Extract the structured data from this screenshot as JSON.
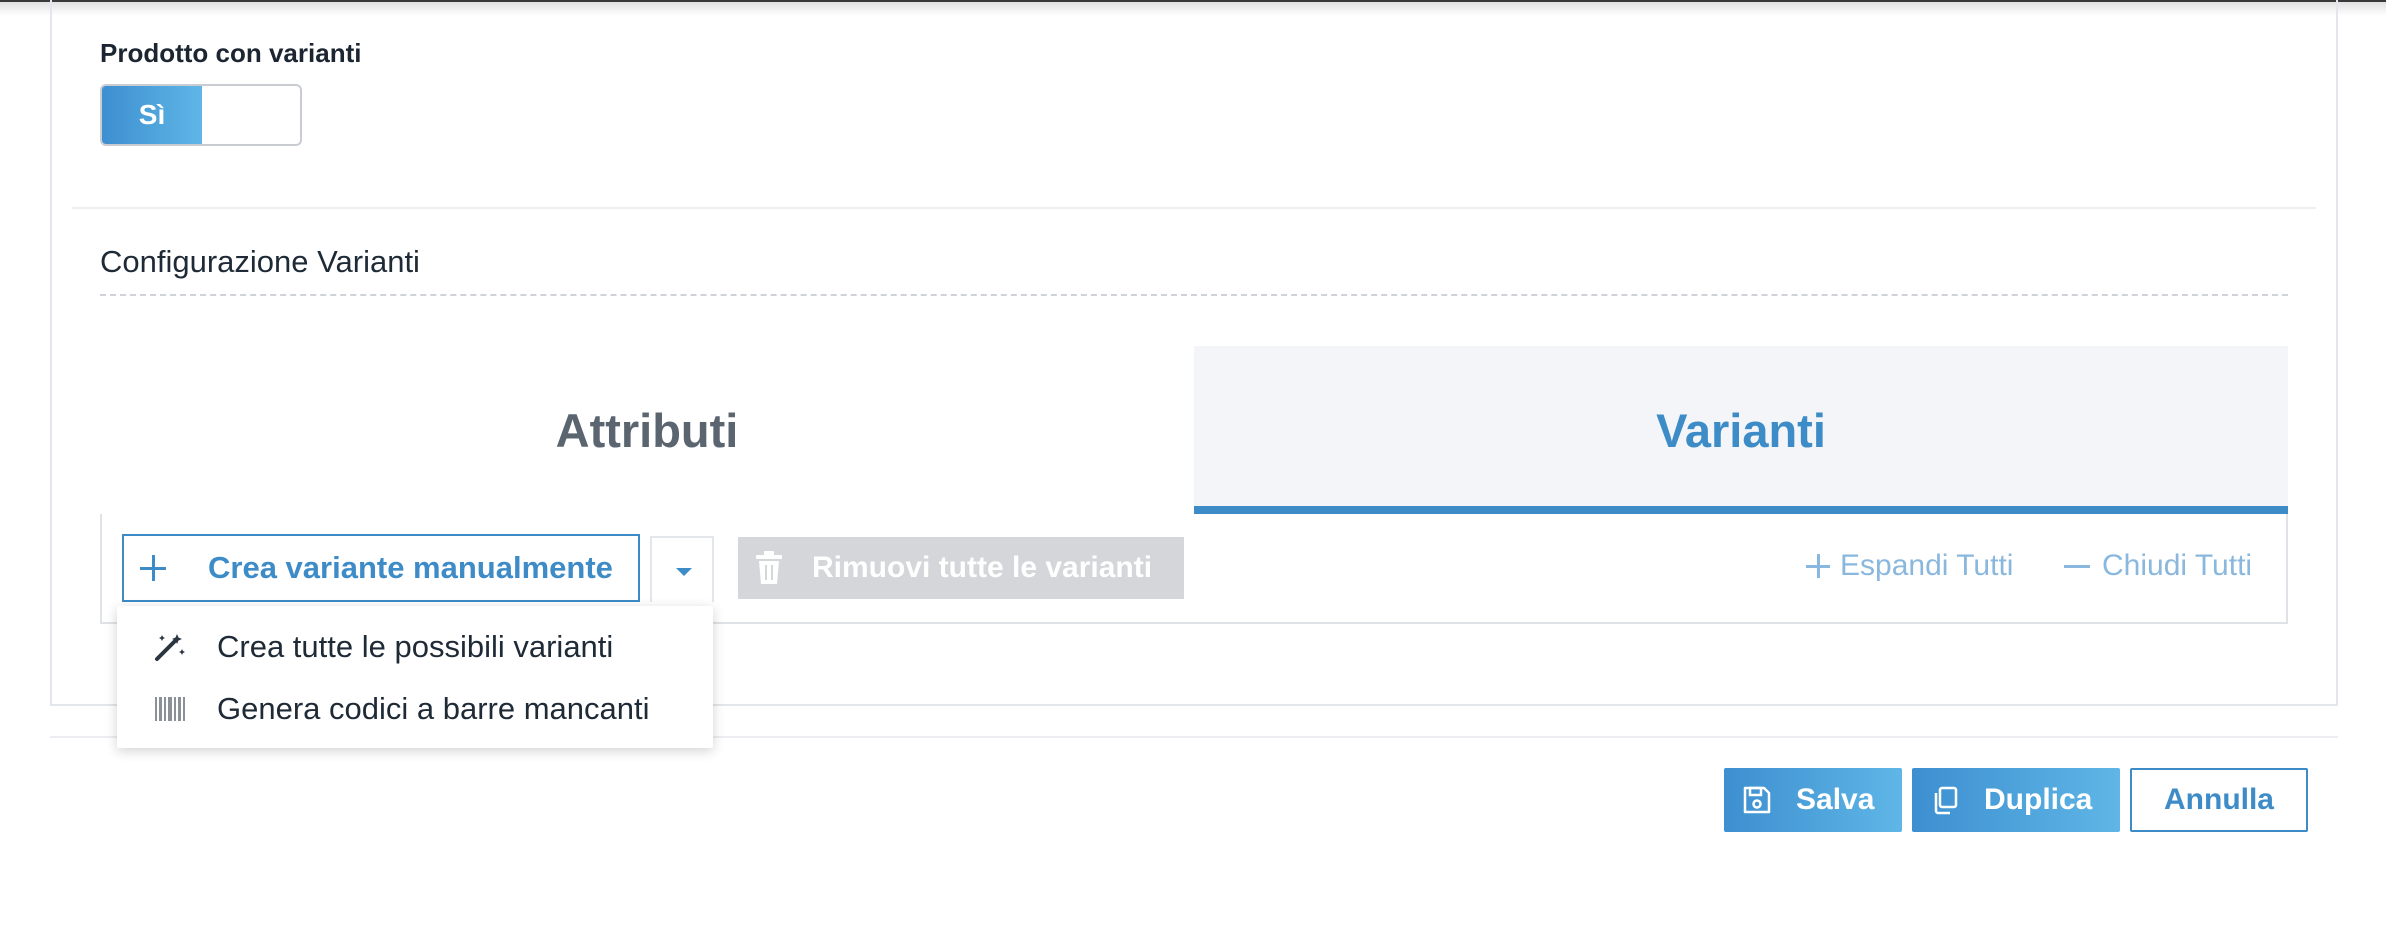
{
  "product_variants": {
    "label": "Prodotto con varianti",
    "toggle_on_label": "Sì"
  },
  "config": {
    "title": "Configurazione Varianti"
  },
  "tabs": [
    {
      "label": "Attributi",
      "active": false
    },
    {
      "label": "Varianti",
      "active": true
    }
  ],
  "toolbar": {
    "create_manual_label": "Crea variante manualmente",
    "remove_all_label": "Rimuovi tutte le varianti",
    "expand_all_label": "Espandi Tutti",
    "collapse_all_label": "Chiudi Tutti"
  },
  "dropdown": {
    "items": [
      {
        "label": "Crea tutte le possibili varianti",
        "icon": "magic-wand-icon"
      },
      {
        "label": "Genera codici a barre mancanti",
        "icon": "barcode-icon"
      }
    ]
  },
  "footer": {
    "save_label": "Salva",
    "duplicate_label": "Duplica",
    "cancel_label": "Annulla"
  },
  "colors": {
    "accent": "#3d8bc7",
    "accent_light": "#5fb6e6",
    "disabled": "#d4d6d9",
    "muted_link": "#8ab7dd",
    "active_tab_bg": "#f3f5f8"
  }
}
